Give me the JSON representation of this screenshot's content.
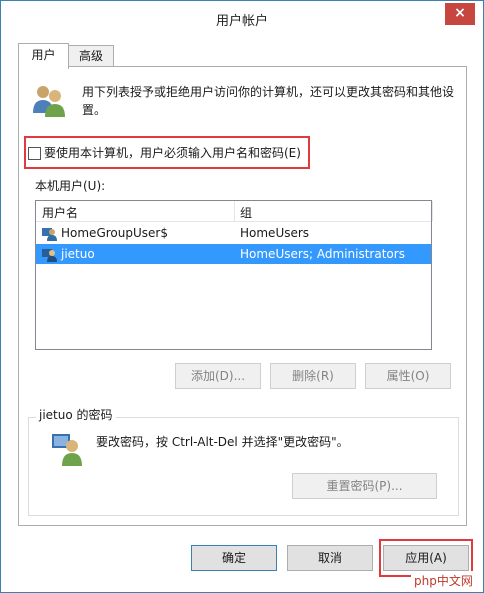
{
  "window": {
    "title": "用户帐户",
    "close_label": "×"
  },
  "tabs": [
    {
      "label": "用户"
    },
    {
      "label": "高级"
    }
  ],
  "users_tab": {
    "description": "用下列表授予或拒绝用户访问你的计算机，还可以更改其密码和其他设置。",
    "require_login_label": "要使用本计算机，用户必须输入用户名和密码(E)",
    "require_login_checked": false,
    "list_label": "本机用户(U):",
    "columns": [
      "用户名",
      "组"
    ],
    "rows": [
      {
        "name": "HomeGroupUser$",
        "group": "HomeUsers",
        "selected": false
      },
      {
        "name": "jietuo",
        "group": "HomeUsers; Administrators",
        "selected": true
      }
    ],
    "buttons": {
      "add": "添加(D)...",
      "remove": "删除(R)",
      "properties": "属性(O)"
    },
    "password_group": {
      "legend": "jietuo 的密码",
      "text": "要改密码，按 Ctrl-Alt-Del 并选择\"更改密码\"。",
      "reset_button": "重置密码(P)..."
    }
  },
  "footer": {
    "ok": "确定",
    "cancel": "取消",
    "apply": "应用(A)"
  },
  "watermark": "php中文网",
  "colors": {
    "highlight": "#e0393e",
    "selection": "#3399ff",
    "close": "#c7463f"
  }
}
